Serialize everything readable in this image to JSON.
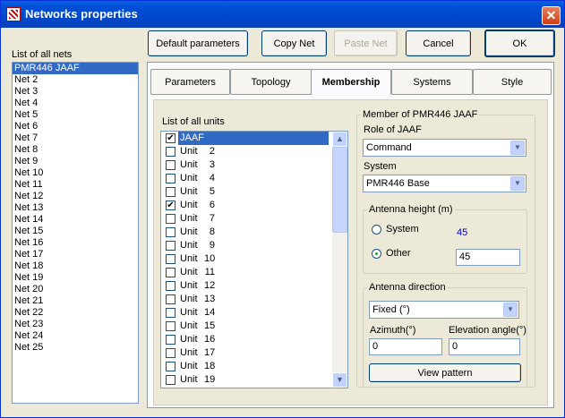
{
  "window": {
    "title": "Networks properties",
    "close_label": "✕"
  },
  "toolbar": {
    "default_params": "Default parameters",
    "copy_net": "Copy Net",
    "paste_net": "Paste Net",
    "cancel": "Cancel",
    "ok": "OK"
  },
  "nets": {
    "label": "List of all nets",
    "items": [
      "PMR446 JAAF",
      "Net  2",
      "Net  3",
      "Net  4",
      "Net  5",
      "Net  6",
      "Net  7",
      "Net  8",
      "Net  9",
      "Net 10",
      "Net 11",
      "Net 12",
      "Net 13",
      "Net 14",
      "Net 15",
      "Net 16",
      "Net 17",
      "Net 18",
      "Net 19",
      "Net 20",
      "Net 21",
      "Net 22",
      "Net 23",
      "Net 24",
      "Net 25"
    ],
    "selected": 0
  },
  "tabs": {
    "items": [
      "Parameters",
      "Topology",
      "Membership",
      "Systems",
      "Style"
    ],
    "active": 2
  },
  "units": {
    "label": "List of all units",
    "items": [
      {
        "name": "JAAF",
        "num": "",
        "checked": true
      },
      {
        "name": "Unit",
        "num": "2",
        "checked": false
      },
      {
        "name": "Unit",
        "num": "3",
        "checked": false
      },
      {
        "name": "Unit",
        "num": "4",
        "checked": false
      },
      {
        "name": "Unit",
        "num": "5",
        "checked": false
      },
      {
        "name": "Unit",
        "num": "6",
        "checked": true
      },
      {
        "name": "Unit",
        "num": "7",
        "checked": false
      },
      {
        "name": "Unit",
        "num": "8",
        "checked": false
      },
      {
        "name": "Unit",
        "num": "9",
        "checked": false
      },
      {
        "name": "Unit",
        "num": "10",
        "checked": false
      },
      {
        "name": "Unit",
        "num": "11",
        "checked": false
      },
      {
        "name": "Unit",
        "num": "12",
        "checked": false
      },
      {
        "name": "Unit",
        "num": "13",
        "checked": false
      },
      {
        "name": "Unit",
        "num": "14",
        "checked": false
      },
      {
        "name": "Unit",
        "num": "15",
        "checked": false
      },
      {
        "name": "Unit",
        "num": "16",
        "checked": false
      },
      {
        "name": "Unit",
        "num": "17",
        "checked": false
      },
      {
        "name": "Unit",
        "num": "18",
        "checked": false
      },
      {
        "name": "Unit",
        "num": "19",
        "checked": false
      }
    ],
    "selected": 0
  },
  "member": {
    "group_label": "Member of PMR446 JAAF",
    "role_label": "Role of JAAF",
    "role_value": "Command",
    "system_label": "System",
    "system_value": "PMR446 Base"
  },
  "antenna_height": {
    "group_label": "Antenna height (m)",
    "system_label": "System",
    "system_value": "45",
    "other_label": "Other",
    "other_value": "45",
    "selected": "Other"
  },
  "antenna_direction": {
    "group_label": "Antenna direction",
    "mode_value": "Fixed (°)",
    "azimuth_label": "Azimuth(°)",
    "azimuth_value": "0",
    "elevation_label": "Elevation angle(°)",
    "elevation_value": "0",
    "view_pattern": "View pattern"
  },
  "colors": {
    "selection": "#316ac5",
    "link_blue": "#0000cc",
    "titlebar": "#0054e3"
  }
}
